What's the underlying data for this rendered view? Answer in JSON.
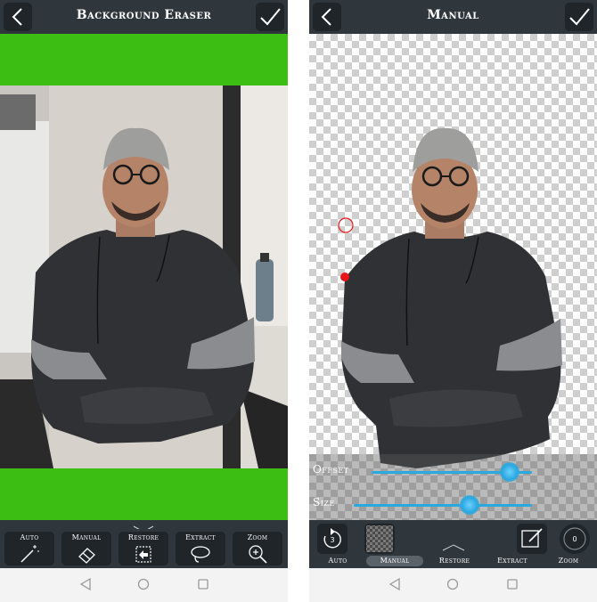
{
  "left_screen": {
    "title": "Background Eraser",
    "canvas_bg_color": "#3cbe12",
    "tools": [
      {
        "label": "Auto",
        "icon": "magic-wand-icon"
      },
      {
        "label": "Manual",
        "icon": "eraser-icon"
      },
      {
        "label": "Restore",
        "icon": "restore-icon"
      },
      {
        "label": "Extract",
        "icon": "extract-icon"
      },
      {
        "label": "Zoom",
        "icon": "zoom-icon"
      }
    ]
  },
  "right_screen": {
    "title": "Manual",
    "offset_label": "Offset",
    "size_label": "Size",
    "offset_value": 0.86,
    "size_value": 0.65,
    "undo_count": "3",
    "zoom_count": "0",
    "tabs": [
      {
        "label": "Auto",
        "active": false
      },
      {
        "label": "Manual",
        "active": true
      },
      {
        "label": "Restore",
        "active": false
      },
      {
        "label": "Extract",
        "active": false
      },
      {
        "label": "Zoom",
        "active": false
      }
    ]
  },
  "colors": {
    "toolbar": "#2f373d",
    "button": "#1f2529",
    "slider_accent": "#2aa8e0",
    "cursor_red": "#e8141b"
  },
  "navigation": [
    "back-icon",
    "home-icon",
    "recents-icon"
  ]
}
